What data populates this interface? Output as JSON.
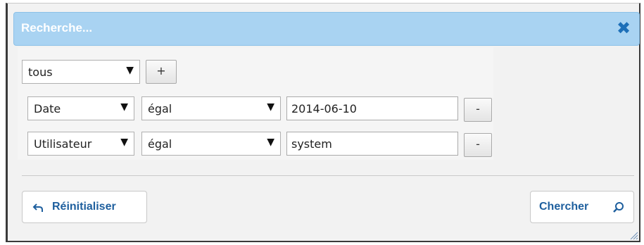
{
  "dialog": {
    "title": "Recherche...",
    "close_icon": "✖"
  },
  "filters": {
    "group_operator": "tous",
    "add_label": "+",
    "rows": [
      {
        "field": "Date",
        "operator": "égal",
        "value": "2014-06-10",
        "remove_label": "-"
      },
      {
        "field": "Utilisateur",
        "operator": "égal",
        "value": "system",
        "remove_label": "-"
      }
    ]
  },
  "actions": {
    "reset_label": "Réinitialiser",
    "search_label": "Chercher"
  },
  "colors": {
    "titlebar": "#a9d3f2",
    "accent": "#1e5f9e"
  }
}
